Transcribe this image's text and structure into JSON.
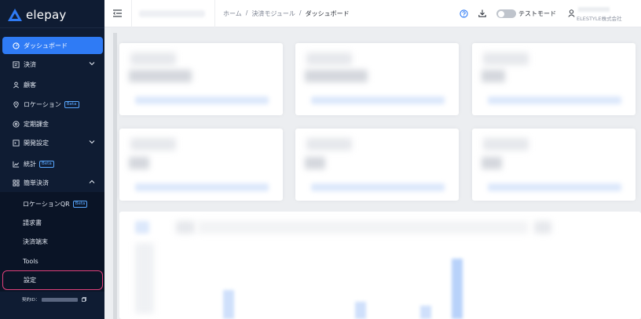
{
  "brand": {
    "name": "elepay",
    "accent": "#2f7bf5",
    "sidebar_bg": "#0f1c33"
  },
  "sidebar": {
    "items": [
      {
        "label": "ダッシュボード",
        "icon": "dashboard-icon",
        "active": true
      },
      {
        "label": "決済",
        "icon": "payment-icon",
        "expandable": true,
        "expanded": false
      },
      {
        "label": "顧客",
        "icon": "customer-icon"
      },
      {
        "label": "ロケーション",
        "icon": "location-icon",
        "badge": "Beta"
      },
      {
        "label": "定期課金",
        "icon": "subscription-icon"
      },
      {
        "label": "開発設定",
        "icon": "code-icon",
        "expandable": true,
        "expanded": false
      },
      {
        "label": "統計",
        "icon": "chart-icon",
        "badge": "Beta"
      },
      {
        "label": "簡単決済",
        "icon": "qr-grid-icon",
        "expandable": true,
        "expanded": true
      }
    ],
    "sub_items": [
      {
        "label": "ロケーションQR",
        "badge": "Beta"
      },
      {
        "label": "請求書"
      },
      {
        "label": "決済端末"
      },
      {
        "label": "Tools"
      },
      {
        "label": "設定",
        "highlighted": true
      }
    ],
    "contract_label": "契約ID："
  },
  "header": {
    "breadcrumb": [
      "ホーム",
      "決済モジュール",
      "ダッシュボード"
    ],
    "breadcrumb_separator": "/",
    "test_mode_label": "テストモード",
    "test_mode_on": false,
    "company": "ELESTYLE株式会社"
  }
}
